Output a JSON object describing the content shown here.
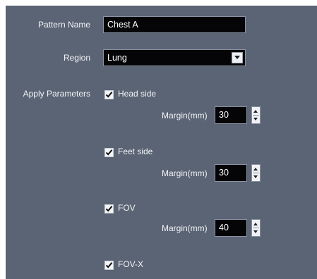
{
  "form": {
    "pattern_name_label": "Pattern Name",
    "pattern_name_value": "Chest A",
    "region_label": "Region",
    "region_value": "Lung",
    "apply_parameters_label": "Apply Parameters",
    "options": [
      {
        "label": "Head side",
        "checked": true,
        "margin_label": "Margin(mm)",
        "margin_value": "30"
      },
      {
        "label": "Feet side",
        "checked": true,
        "margin_label": "Margin(mm)",
        "margin_value": "30"
      },
      {
        "label": "FOV",
        "checked": true,
        "margin_label": "Margin(mm)",
        "margin_value": "40"
      },
      {
        "label": "FOV-X",
        "checked": true
      }
    ]
  },
  "icons": {
    "dropdown": "chevron-down-icon",
    "checkmark": "checkmark-icon",
    "spinner_up": "spinner-up-icon",
    "spinner_down": "spinner-down-icon"
  },
  "colors": {
    "panel_background": "#5b6474",
    "field_background": "#050507",
    "text": "#ffffff"
  }
}
